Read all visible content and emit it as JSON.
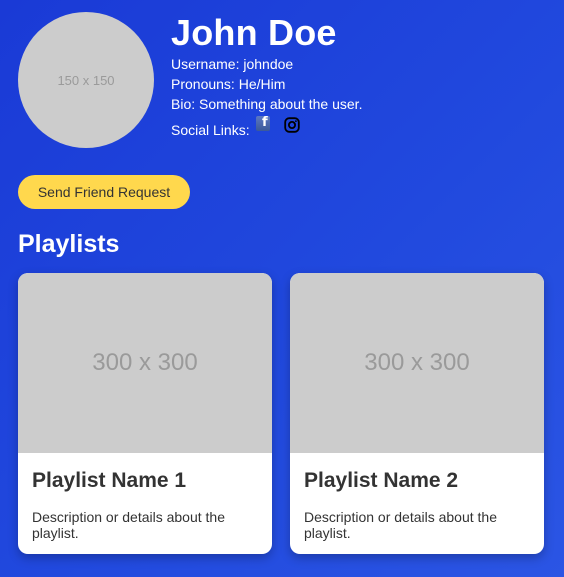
{
  "profile": {
    "avatar_placeholder": "150 x 150",
    "name": "John Doe",
    "username": "Username: johndoe",
    "pronouns": "Pronouns: He/Him",
    "bio": "Bio: Something about the user.",
    "social_label": "Social Links:",
    "social_icons": [
      "facebook-icon",
      "instagram-icon"
    ]
  },
  "actions": {
    "friend_request_label": "Send Friend Request"
  },
  "playlists": {
    "title": "Playlists",
    "items": [
      {
        "cover_placeholder": "300 x 300",
        "name": "Playlist Name 1",
        "description": "Description or details about the playlist."
      },
      {
        "cover_placeholder": "300 x 300",
        "name": "Playlist Name 2",
        "description": "Description or details about the playlist."
      }
    ]
  },
  "colors": {
    "background": "#1f44db",
    "button": "#ffd84d",
    "placeholder": "#cccccc",
    "facebook": "#3b5998"
  }
}
